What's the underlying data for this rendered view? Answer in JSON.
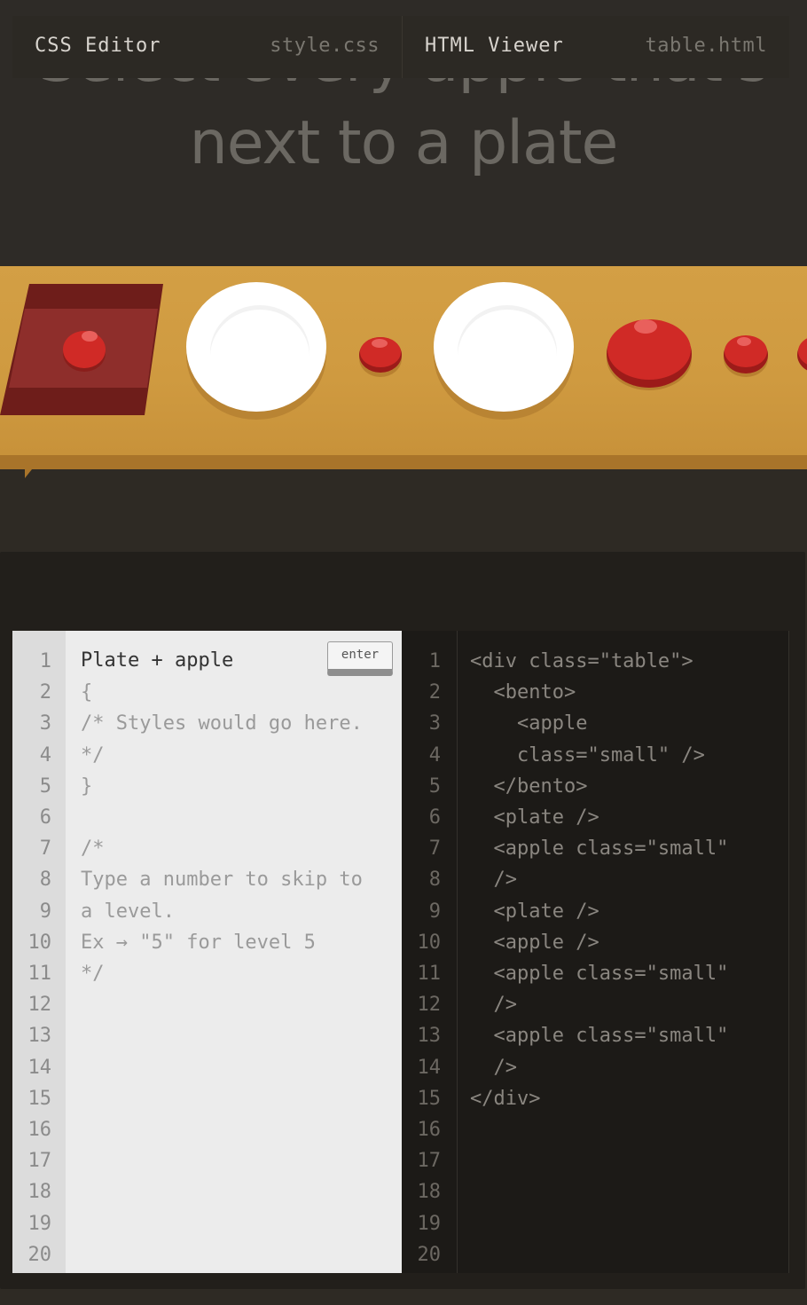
{
  "instruction": {
    "line1": "Select every apple that's",
    "line2": "next to a plate"
  },
  "colors": {
    "table": "#d39f45",
    "apple": "#d02a26",
    "plate": "#ffffff",
    "bento": "#6e1d1a"
  },
  "css_editor": {
    "title": "CSS Editor",
    "filename": "style.css",
    "input_value": "Plate + apple",
    "enter_label": "enter",
    "line_numbers": [
      "1",
      "2",
      "3",
      "4",
      "5",
      "6",
      "7",
      "8",
      "9",
      "10",
      "11",
      "12",
      "13",
      "14",
      "15",
      "16",
      "17",
      "18",
      "19",
      "20"
    ],
    "lines": [
      "",
      "{",
      "/* Styles would go here.",
      "*/",
      "}",
      "",
      "/*",
      "Type a number to skip to",
      "a level.",
      "Ex → \"5\" for level 5",
      "*/"
    ]
  },
  "html_viewer": {
    "title": "HTML Viewer",
    "filename": "table.html",
    "line_numbers": [
      "1",
      "2",
      "3",
      "4",
      "5",
      "6",
      "7",
      "8",
      "9",
      "10",
      "11",
      "12",
      "13",
      "14",
      "15",
      "16",
      "17",
      "18",
      "19",
      "20"
    ],
    "lines": [
      "<div class=\"table\">",
      "  <bento>",
      "    <apple",
      "    class=\"small\" />",
      "  </bento>",
      "  <plate />",
      "  <apple class=\"small\"",
      "  />",
      "  <plate />",
      "  <apple />",
      "  <apple class=\"small\"",
      "  />",
      "  <apple class=\"small\"",
      "  />",
      "</div>"
    ]
  }
}
